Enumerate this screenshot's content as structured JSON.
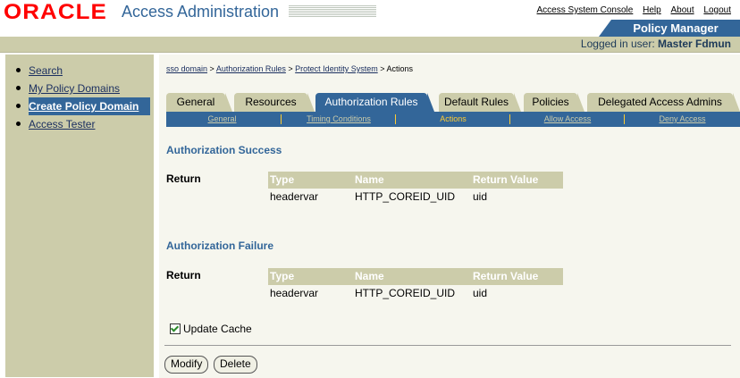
{
  "header": {
    "logo": "ORACLE",
    "app_title": "Access Administration",
    "links": [
      "Access System Console",
      "Help",
      "About",
      "Logout"
    ],
    "policy_manager_tab": "Policy Manager",
    "logged_in_prefix": "Logged in user: ",
    "logged_in_user": "Master Fdmun"
  },
  "sidebar": {
    "items": [
      {
        "label": "Search"
      },
      {
        "label": "My Policy Domains"
      },
      {
        "label": "Create Policy Domain",
        "active": true
      },
      {
        "label": "Access Tester"
      }
    ]
  },
  "breadcrumb": {
    "items": [
      "sso domain",
      "Authorization Rules",
      "Protect Identity System"
    ],
    "current": "Actions",
    "separator": ">"
  },
  "tabs": [
    "General",
    "Resources",
    "Authorization Rules",
    "Default Rules",
    "Policies",
    "Delegated Access Admins"
  ],
  "active_tab": "Authorization Rules",
  "subtabs": [
    "General",
    "Timing Conditions",
    "Actions",
    "Allow Access",
    "Deny Access"
  ],
  "active_subtab": "Actions",
  "success": {
    "title": "Authorization Success",
    "return_label": "Return",
    "columns": [
      "Type",
      "Name",
      "Return Value"
    ],
    "row": {
      "type": "headervar",
      "name": "HTTP_COREID_UID",
      "value": "uid"
    }
  },
  "failure": {
    "title": "Authorization Failure",
    "return_label": "Return",
    "columns": [
      "Type",
      "Name",
      "Return Value"
    ],
    "row": {
      "type": "headervar",
      "name": "HTTP_COREID_UID",
      "value": "uid"
    }
  },
  "update_cache": {
    "label": "Update Cache",
    "checked": true
  },
  "buttons": {
    "modify": "Modify",
    "delete": "Delete"
  },
  "colors": {
    "brand_red": "#ff0000",
    "nav_blue": "#336699",
    "panel_tan": "#ccccaa",
    "highlight": "#ffcc33"
  }
}
